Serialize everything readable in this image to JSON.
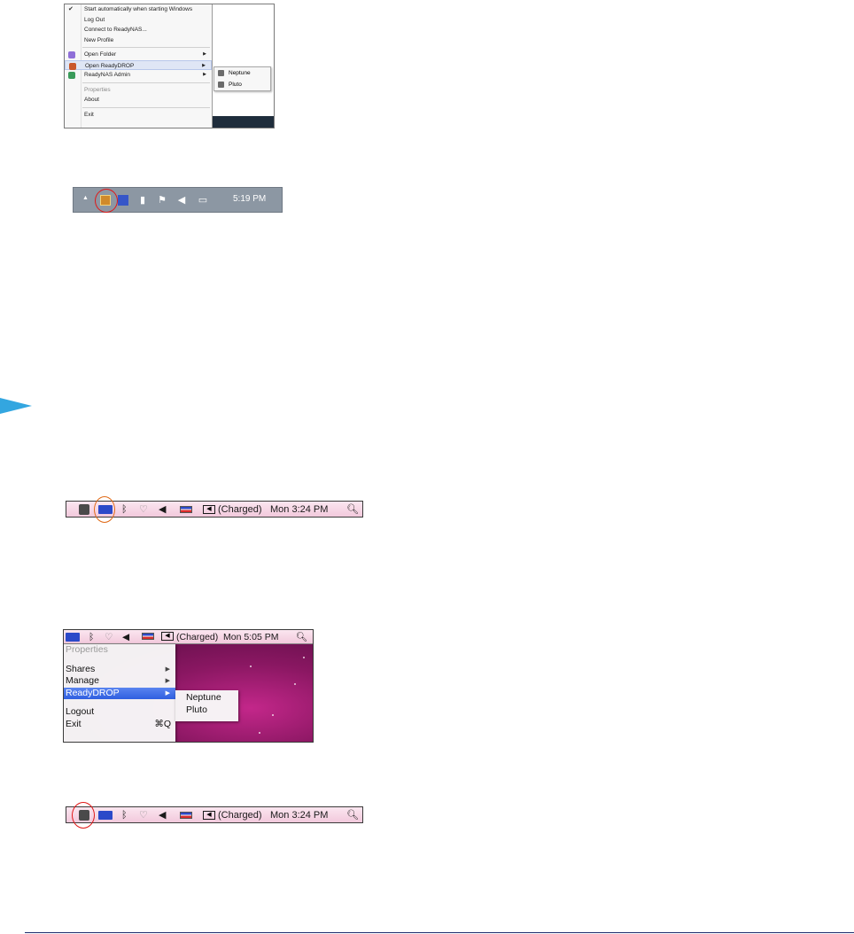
{
  "win_menu": {
    "items": [
      {
        "label": "Start automatically when starting Windows",
        "checked": true
      },
      {
        "label": "Log Out"
      },
      {
        "label": "Connect to ReadyNAS..."
      },
      {
        "label": "New Profile"
      },
      {
        "label": "Open Folder",
        "submenu": true
      },
      {
        "label": "Open ReadyDROP",
        "submenu": true,
        "highlighted": true
      },
      {
        "label": "ReadyNAS Admin",
        "submenu": true
      },
      {
        "label": "Properties",
        "disabled": true
      },
      {
        "label": "About"
      },
      {
        "label": "Exit"
      }
    ],
    "submenu": [
      "Neptune",
      "Pluto"
    ]
  },
  "win_tray": {
    "time": "5:19 PM"
  },
  "mac_bar_top": {
    "status": "(Charged)",
    "clock": "Mon 3:24 PM"
  },
  "mac_shot": {
    "status": "(Charged)",
    "clock": "Mon 5:05 PM",
    "menu": [
      {
        "label": "Properties",
        "disabled": true
      },
      {
        "label": "Shares",
        "submenu": true
      },
      {
        "label": "Manage",
        "submenu": true
      },
      {
        "label": "ReadyDROP",
        "submenu": true,
        "highlighted": true
      },
      {
        "label": "Logout"
      },
      {
        "label": "Exit",
        "shortcut": "⌘Q"
      }
    ],
    "submenu": [
      "Neptune",
      "Pluto"
    ]
  },
  "mac_bar_bottom": {
    "status": "(Charged)",
    "clock": "Mon 3:24 PM"
  },
  "colors": {
    "annotation_circle": "#e01818",
    "bullet_arrow": "#33a6e0",
    "mac_highlight": "#2f5fe0"
  }
}
